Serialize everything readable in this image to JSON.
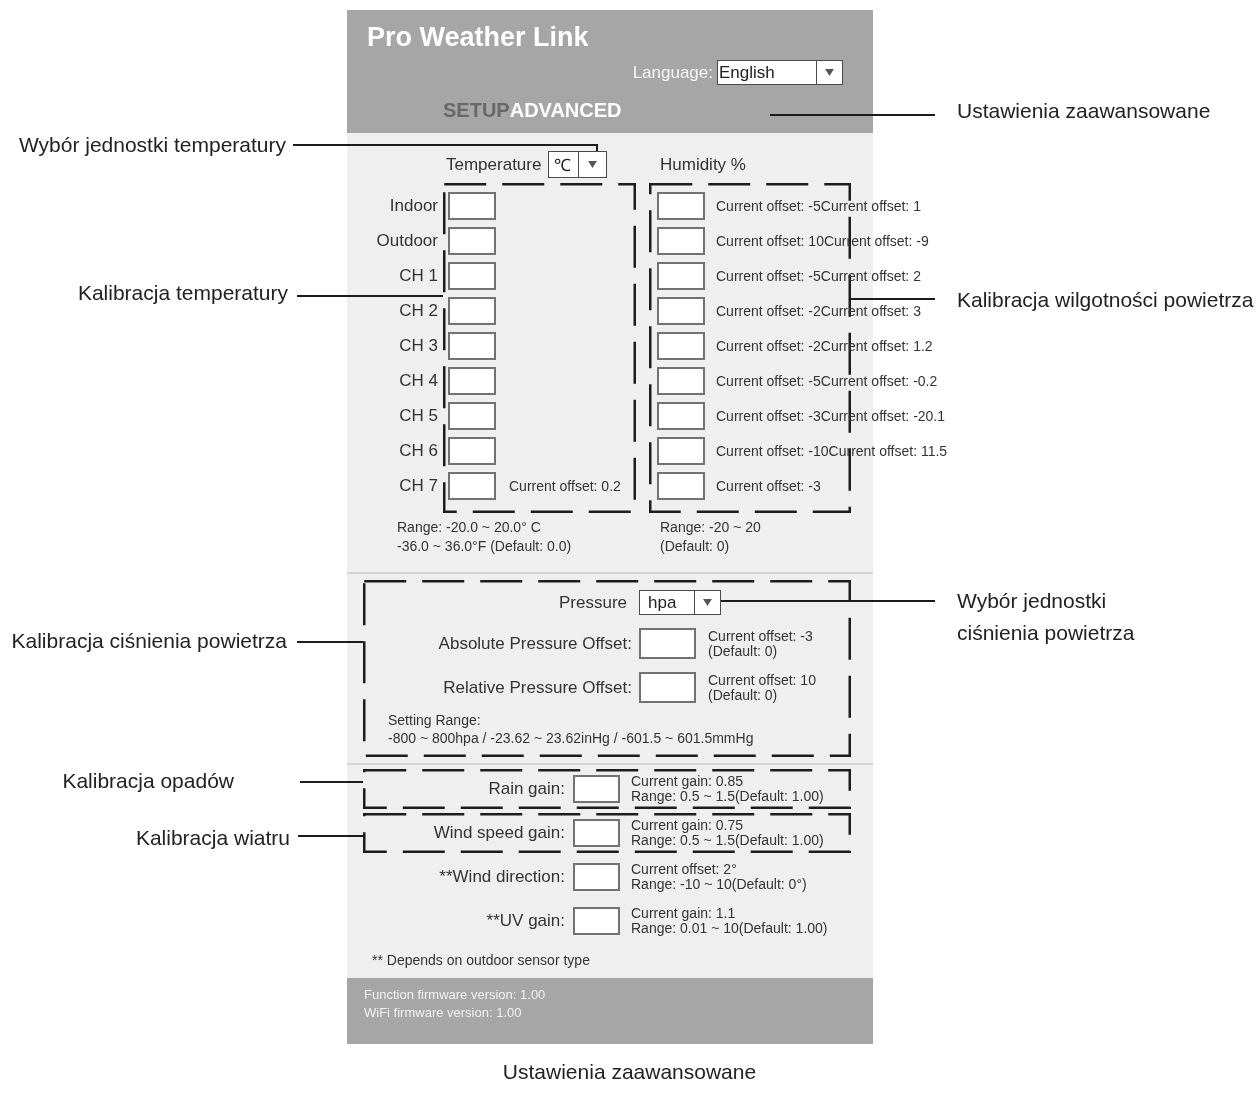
{
  "header": {
    "title": "Pro Weather Link",
    "language_label": "Language:",
    "language": "English"
  },
  "tabs": [
    {
      "label": "SETUP",
      "selected": false
    },
    {
      "label": "ADVANCED",
      "selected": true
    }
  ],
  "temperature": {
    "title": "Temperature",
    "unit": "℃",
    "rows": [
      {
        "label": "Indoor"
      },
      {
        "label": "Outdoor"
      },
      {
        "label": "CH 1"
      },
      {
        "label": "CH 2"
      },
      {
        "label": "CH 3"
      },
      {
        "label": "CH 4"
      },
      {
        "label": "CH 5"
      },
      {
        "label": "CH 6"
      },
      {
        "label": "CH 7",
        "note": "Current offset: 0.2"
      }
    ],
    "range": [
      "Range: -20.0 ~ 20.0° C",
      "-36.0 ~ 36.0°F (Default: 0.0)"
    ]
  },
  "humidity": {
    "title": "Humidity %",
    "rows": [
      {
        "note": "Current offset: -5Current offset: 1"
      },
      {
        "note": "Current offset: 10Current offset: -9"
      },
      {
        "note": "Current offset: -5Current offset: 2"
      },
      {
        "note": "Current offset: -2Current offset: 3"
      },
      {
        "note": "Current offset: -2Current offset: 1.2"
      },
      {
        "note": "Current offset: -5Current offset: -0.2"
      },
      {
        "note": "Current offset: -3Current offset: -20.1"
      },
      {
        "note": "Current offset: -10Current offset: 11.5"
      },
      {
        "note": "Current offset: -3"
      }
    ],
    "range": [
      "Range: -20 ~ 20",
      "(Default: 0)"
    ]
  },
  "pressure": {
    "label": "Pressure",
    "unit": "hpa",
    "rows": [
      {
        "label": "Absolute Pressure Offset:",
        "notes": [
          "Current offset: -3",
          "(Default: 0)"
        ]
      },
      {
        "label": "Relative Pressure Offset:",
        "notes": [
          "Current offset: 10",
          "(Default: 0)"
        ]
      }
    ],
    "range": [
      "Setting Range:",
      "-800 ~ 800hpa / -23.62 ~ 23.62inHg / -601.5 ~ 601.5mmHg"
    ]
  },
  "gains": {
    "rows": [
      {
        "label": "Rain gain:",
        "framed": true,
        "notes": [
          "Current gain: 0.85",
          "Range: 0.5 ~ 1.5(Default: 1.00)"
        ]
      },
      {
        "label": "Wind speed gain:",
        "framed": true,
        "notes": [
          "Current gain: 0.75",
          "Range: 0.5 ~ 1.5(Default: 1.00)"
        ]
      },
      {
        "label": "**Wind direction:",
        "framed": false,
        "notes": [
          "Current offset: 2°",
          "Range: -10 ~ 10(Default: 0°)"
        ]
      },
      {
        "label": "**UV gain:",
        "framed": false,
        "notes": [
          "Current gain: 1.1",
          "Range: 0.01 ~ 10(Default: 1.00)"
        ]
      }
    ],
    "footnote": "** Depends on outdoor sensor type"
  },
  "footer": [
    "Function firmware version: 1.00",
    "WiFi firmware version: 1.00"
  ],
  "callouts": [
    {
      "text": "Ustawienia zaawansowane"
    },
    {
      "text": "Wybór jednostki temperatury"
    },
    {
      "text": "Kalibracja temperatury"
    },
    {
      "text": "Kalibracja wilgotności powietrza"
    },
    {
      "text": "Wybór jednostki ciśnienia powietrza"
    },
    {
      "text": "Kalibracja ciśnienia powietrza"
    },
    {
      "text": "Kalibracja opadów"
    },
    {
      "text": "Kalibracja wiatru"
    }
  ],
  "caption": "Ustawienia zaawansowane"
}
